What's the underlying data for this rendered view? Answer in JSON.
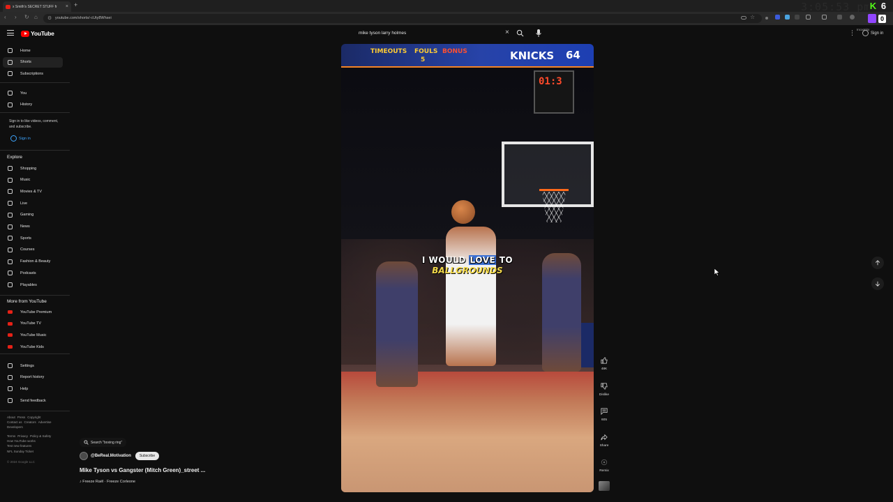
{
  "browser": {
    "tab_title": "x Smith's SECRET STUFF fr",
    "url": "youtube.com/shorts/-cUty8Whsei",
    "clock": "3:05:53 pm",
    "kick_count": "6",
    "twitch_count": "0",
    "ext_label": "Incognito"
  },
  "header": {
    "logo_text": "YouTube",
    "search_value": "mike tyson larry holmes",
    "signin_label": "Sign in"
  },
  "sidebar": {
    "main": [
      {
        "label": "Home",
        "icon": "home-icon"
      },
      {
        "label": "Shorts",
        "icon": "shorts-icon"
      },
      {
        "label": "Subscriptions",
        "icon": "subscriptions-icon"
      }
    ],
    "you": [
      {
        "label": "You",
        "icon": "you-icon"
      },
      {
        "label": "History",
        "icon": "history-icon"
      }
    ],
    "signin_note": "Sign in to like videos, comment, and subscribe.",
    "signin_label": "Sign in",
    "explore_title": "Explore",
    "explore": [
      {
        "label": "Shopping"
      },
      {
        "label": "Music"
      },
      {
        "label": "Movies & TV"
      },
      {
        "label": "Live"
      },
      {
        "label": "Gaming"
      },
      {
        "label": "News"
      },
      {
        "label": "Sports"
      },
      {
        "label": "Courses"
      },
      {
        "label": "Fashion & Beauty"
      },
      {
        "label": "Podcasts"
      },
      {
        "label": "Playables"
      }
    ],
    "more_title": "More from YouTube",
    "more": [
      {
        "label": "YouTube Premium"
      },
      {
        "label": "YouTube TV"
      },
      {
        "label": "YouTube Music"
      },
      {
        "label": "YouTube Kids"
      }
    ],
    "settings": [
      {
        "label": "Settings"
      },
      {
        "label": "Report history"
      },
      {
        "label": "Help"
      },
      {
        "label": "Send feedback"
      }
    ],
    "footer_line1": [
      "About",
      "Press",
      "Copyright"
    ],
    "footer_line2": [
      "Contact us",
      "Creators",
      "Advertise"
    ],
    "footer_line3": [
      "Developers"
    ],
    "footer_line4": [
      "Terms",
      "Privacy",
      "Policy & Safety"
    ],
    "footer_line5": [
      "How YouTube works"
    ],
    "footer_line6": [
      "Test new features"
    ],
    "footer_line7": [
      "NFL Sunday Ticket"
    ],
    "copyright": "© 2024 Google LLC"
  },
  "video": {
    "scoreboard_timeouts": "TIMEOUTS",
    "scoreboard_fouls": "FOULS",
    "scoreboard_bonus": "BONUS",
    "scoreboard_fouls_value": "5",
    "scoreboard_team": "KNICKS",
    "scoreboard_score": "64",
    "shot_clock": "01:3",
    "caption_before": "I WOULD ",
    "caption_highlight": "LOVE",
    "caption_after": " TO",
    "caption_line2": "BALLGROUNDS",
    "search_chip": "Search \"boxing ring\"",
    "channel": "@BeReal.Motivation",
    "subscribe_label": "Subscribe",
    "title": "Mike Tyson vs Gangster (Mitch Green)_street ...",
    "sound": "Freeze Raël · Freeze Corleone"
  },
  "actions": {
    "like_count": "48K",
    "dislike_label": "Dislike",
    "comments_count": "605",
    "share_label": "Share",
    "remix_label": "Remix"
  }
}
